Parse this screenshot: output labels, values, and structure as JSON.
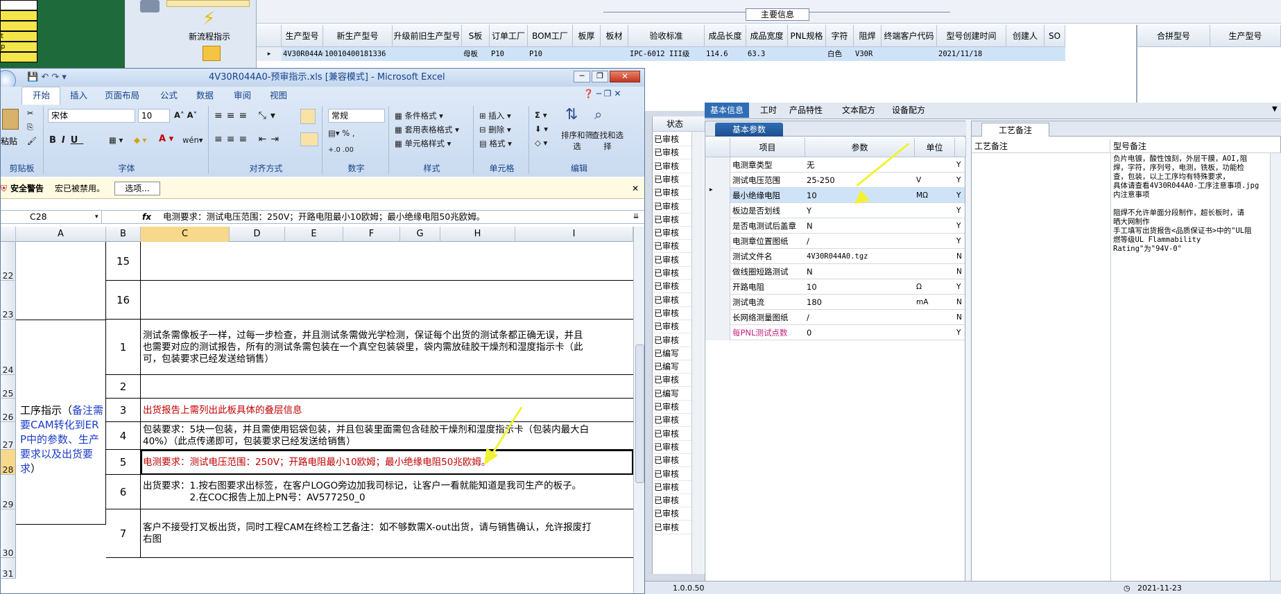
{
  "app": {
    "excel_title": "4V30R044A0-预审指示.xls [兼容模式] - Microsoft Excel"
  },
  "bg": {
    "left_cells": [
      "t",
      "p"
    ],
    "workflow": "新流程指示",
    "main_title": "主要信息",
    "main_cols": [
      "生产型号",
      "新生产型号",
      "升级前旧生产型号",
      "S板",
      "订单工厂",
      "BOM工厂",
      "板厚",
      "板材",
      "验收标准",
      "成品长度",
      "成品宽度",
      "PNL规格",
      "字符",
      "阻焊",
      "终端客户代码",
      "型号创建时间",
      "创建人",
      "SO"
    ],
    "main_row": [
      "4V30R044A0",
      "10010400181336",
      "",
      "母板",
      "P10",
      "P10",
      "",
      "",
      "IPC-6012 III级",
      "114.6",
      "63.3",
      "",
      "白色",
      "V30R",
      "",
      "2021/11/18",
      "",
      ""
    ],
    "merge_cols": [
      "合拼型号",
      "生产型号"
    ]
  },
  "excel": {
    "tabs": [
      "开始",
      "插入",
      "页面布局",
      "公式",
      "数据",
      "审阅",
      "视图"
    ],
    "groups": [
      "剪贴板",
      "字体",
      "对齐方式",
      "数字",
      "样式",
      "单元格",
      "编辑"
    ],
    "font_name": "宋体",
    "font_size": "10",
    "paste": "粘贴",
    "num_format": "常规",
    "styles": [
      "条件格式",
      "套用表格格式",
      "单元格样式"
    ],
    "cells": [
      "插入",
      "删除",
      "格式"
    ],
    "edit": [
      "排序和筛选",
      "查找和选择"
    ],
    "security": {
      "title": "安全警告",
      "msg": "宏已被禁用。",
      "btn": "选项..."
    },
    "name_box": "C28",
    "fx": "fx",
    "formula": "电测要求：测试电压范围：250V；开路电阻最小10欧姆；最小绝缘电阻50兆欧姆。",
    "columns": [
      "A",
      "B",
      "C",
      "D",
      "E",
      "F",
      "G",
      "H",
      "I"
    ],
    "rows": [
      {
        "r": "22",
        "n": "15",
        "t": [
          ""
        ]
      },
      {
        "r": "23",
        "n": "16",
        "t": [
          ""
        ]
      },
      {
        "r": "24",
        "n": "1",
        "t": [
          "测试条需像板子一样，过每一步检查，并且测试条需做光学检测，保证每个出货的测试条都正确无误，并且",
          "也需要对应的测试报告，所有的测试条需包装在一个真空包装袋里，袋内需放硅胶干燥剂和湿度指示卡（此",
          "可，包装要求已经发送给销售）"
        ]
      },
      {
        "r": "25",
        "n": "2",
        "t": [
          ""
        ]
      },
      {
        "r": "26",
        "n": "3",
        "t": [
          "出货报告上需列出此板具体的叠层信息"
        ]
      },
      {
        "r": "27",
        "n": "4",
        "t": [
          "包装要求：5块一包装，并且需使用铝袋包装，并且包装里面需包含硅胶干燥剂和湿度指示卡（包装内最大白",
          "40%）（此点传递即可，包装要求已经发送给销售）"
        ]
      },
      {
        "r": "28",
        "n": "5",
        "t": [
          "电测要求：测试电压范围：250V；开路电阻最小10欧姆；最小绝缘电阻50兆欧姆。"
        ]
      },
      {
        "r": "29",
        "n": "6",
        "t": [
          "出货要求：1.按右图要求出标签，在客户LOGO旁边加我司标记，让客户一看就能知道是我司生产的板子。",
          "　　　　　2.在COC报告上加上PN号：AV577250_0"
        ]
      },
      {
        "r": "30",
        "n": "7",
        "t": [
          "客户不接受打叉板出货，同时工程CAM在终检工艺备注：如不够数需X-out出货，请与销售确认，允许报废打",
          "右图"
        ]
      },
      {
        "r": "31",
        "n": "",
        "t": [
          ""
        ]
      }
    ],
    "section_label_black": "工序指示（",
    "section_label_blue": "备注需要CAM转化到ERP中的参数、生产要求以及出货要求",
    "section_label_end": "）"
  },
  "status_col": {
    "header": "状态",
    "items": [
      "已审核",
      "已审核",
      "已审核",
      "已审核",
      "已审核",
      "已审核",
      "已审核",
      "已审核",
      "已审核",
      "已审核",
      "已审核",
      "已审核",
      "已审核",
      "已审核",
      "已审核",
      "已审核",
      "已编写",
      "已编写",
      "已审核",
      "已编写",
      "已审核",
      "已审核",
      "已审核",
      "已审核",
      "已审核",
      "已审核",
      "已审核",
      "已审核",
      "已审核",
      "已审核"
    ]
  },
  "panel": {
    "tabs": [
      "基本信息",
      "工时",
      "产品特性",
      "文本配方",
      "设备配方"
    ],
    "sub_tab": "基本参数",
    "cols": [
      "项目",
      "参数",
      "单位"
    ],
    "rows": [
      {
        "item": "电测章类型",
        "val": "无",
        "unit": "",
        "flag": "Y"
      },
      {
        "item": "测试电压范围",
        "val": "25-250",
        "unit": "V",
        "flag": "Y"
      },
      {
        "item": "最小绝缘电阻",
        "val": "10",
        "unit": "MΩ",
        "flag": "Y"
      },
      {
        "item": "板边是否划线",
        "val": "Y",
        "unit": "",
        "flag": "Y"
      },
      {
        "item": "是否电测试后盖章",
        "val": "N",
        "unit": "",
        "flag": "Y"
      },
      {
        "item": "电测章位置图纸",
        "val": "/",
        "unit": "",
        "flag": "Y"
      },
      {
        "item": "测试文件名",
        "val": "4V30R044A0.tgz",
        "unit": "",
        "flag": "N"
      },
      {
        "item": "做线圈短路测试",
        "val": "N",
        "unit": "",
        "flag": "N"
      },
      {
        "item": "开路电阻",
        "val": "10",
        "unit": "Ω",
        "flag": "Y"
      },
      {
        "item": "测试电流",
        "val": "180",
        "unit": "mA",
        "flag": "N"
      },
      {
        "item": "长网络测量图纸",
        "val": "/",
        "unit": "",
        "flag": "N"
      },
      {
        "item": "每PNL测试点数",
        "val": "0",
        "unit": "",
        "flag": "Y"
      }
    ],
    "craft_tab": "工艺备注",
    "craft_cols": [
      "工艺备注",
      "型号备注"
    ],
    "remark": [
      "负片电镀，酸性蚀刻，外层干膜，AOI,阻",
      "焊，字符，序列号，电测，铣板，功能检",
      "查，包装，以上工序均有特殊要求，",
      "具体请查看4V30R044A0-工序注意事项.jpg",
      "内注意事项",
      "",
      "阻焊不允许单面分段制作，超长板时，请",
      "晒大网制作",
      "手工填写出货报告<品质保证书>中的\"UL阻",
      "燃等级UL Flammability",
      "Rating\"为\"94V-0\""
    ],
    "status_bottom": [
      "1.0.0.50",
      "2021-11-23"
    ]
  }
}
